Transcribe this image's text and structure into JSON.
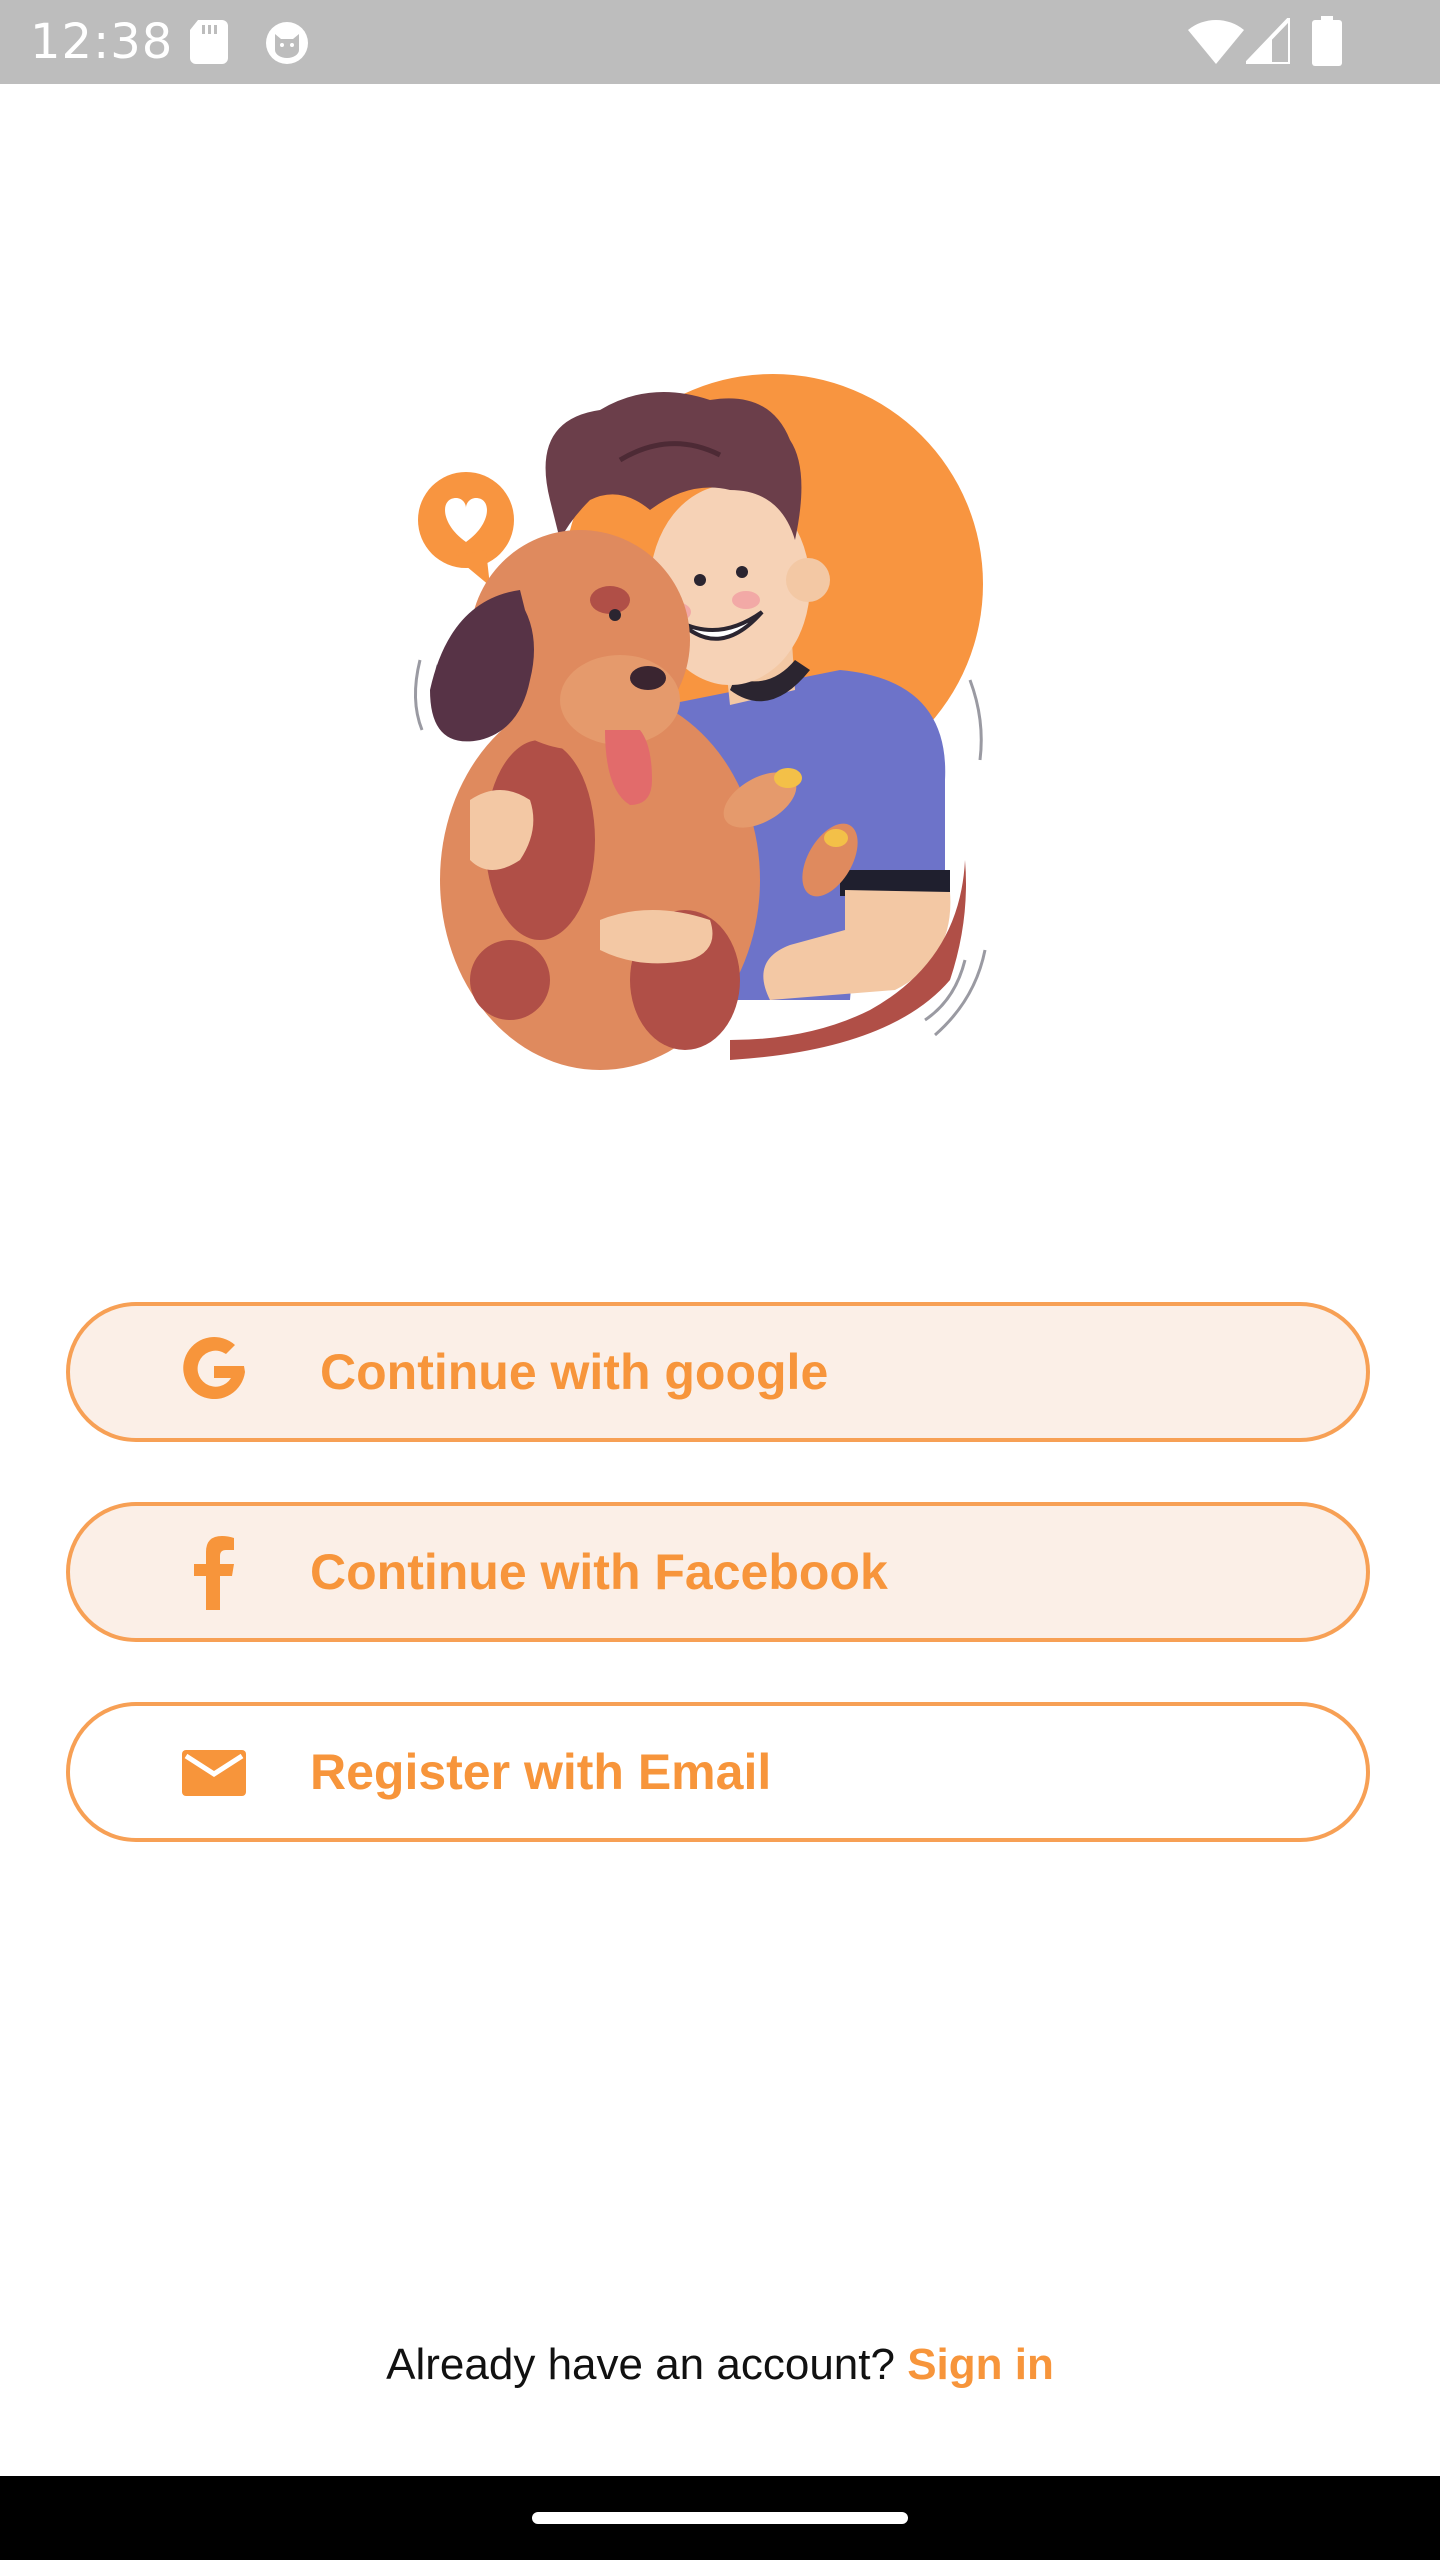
{
  "status_bar": {
    "time": "12:38",
    "icons": [
      "sd-card-icon",
      "cat-notification-icon",
      "wifi-icon",
      "cellular-signal-icon",
      "battery-icon"
    ]
  },
  "hero": {
    "illustration": "man-hugging-dog-illustration"
  },
  "buttons": {
    "google": {
      "label": "Continue with google",
      "icon": "google-icon"
    },
    "facebook": {
      "label": "Continue with Facebook",
      "icon": "facebook-icon"
    },
    "email": {
      "label": "Register with Email",
      "icon": "mail-icon"
    }
  },
  "signin": {
    "prompt": "Already have an account?",
    "link": "Sign in"
  },
  "colors": {
    "accent": "#f7953b",
    "button_border": "#f7a055",
    "button_fill": "#fbefe7",
    "status_bar": "#bdbdbd",
    "shirt": "#6d73c9",
    "dog": "#df8a5e"
  }
}
